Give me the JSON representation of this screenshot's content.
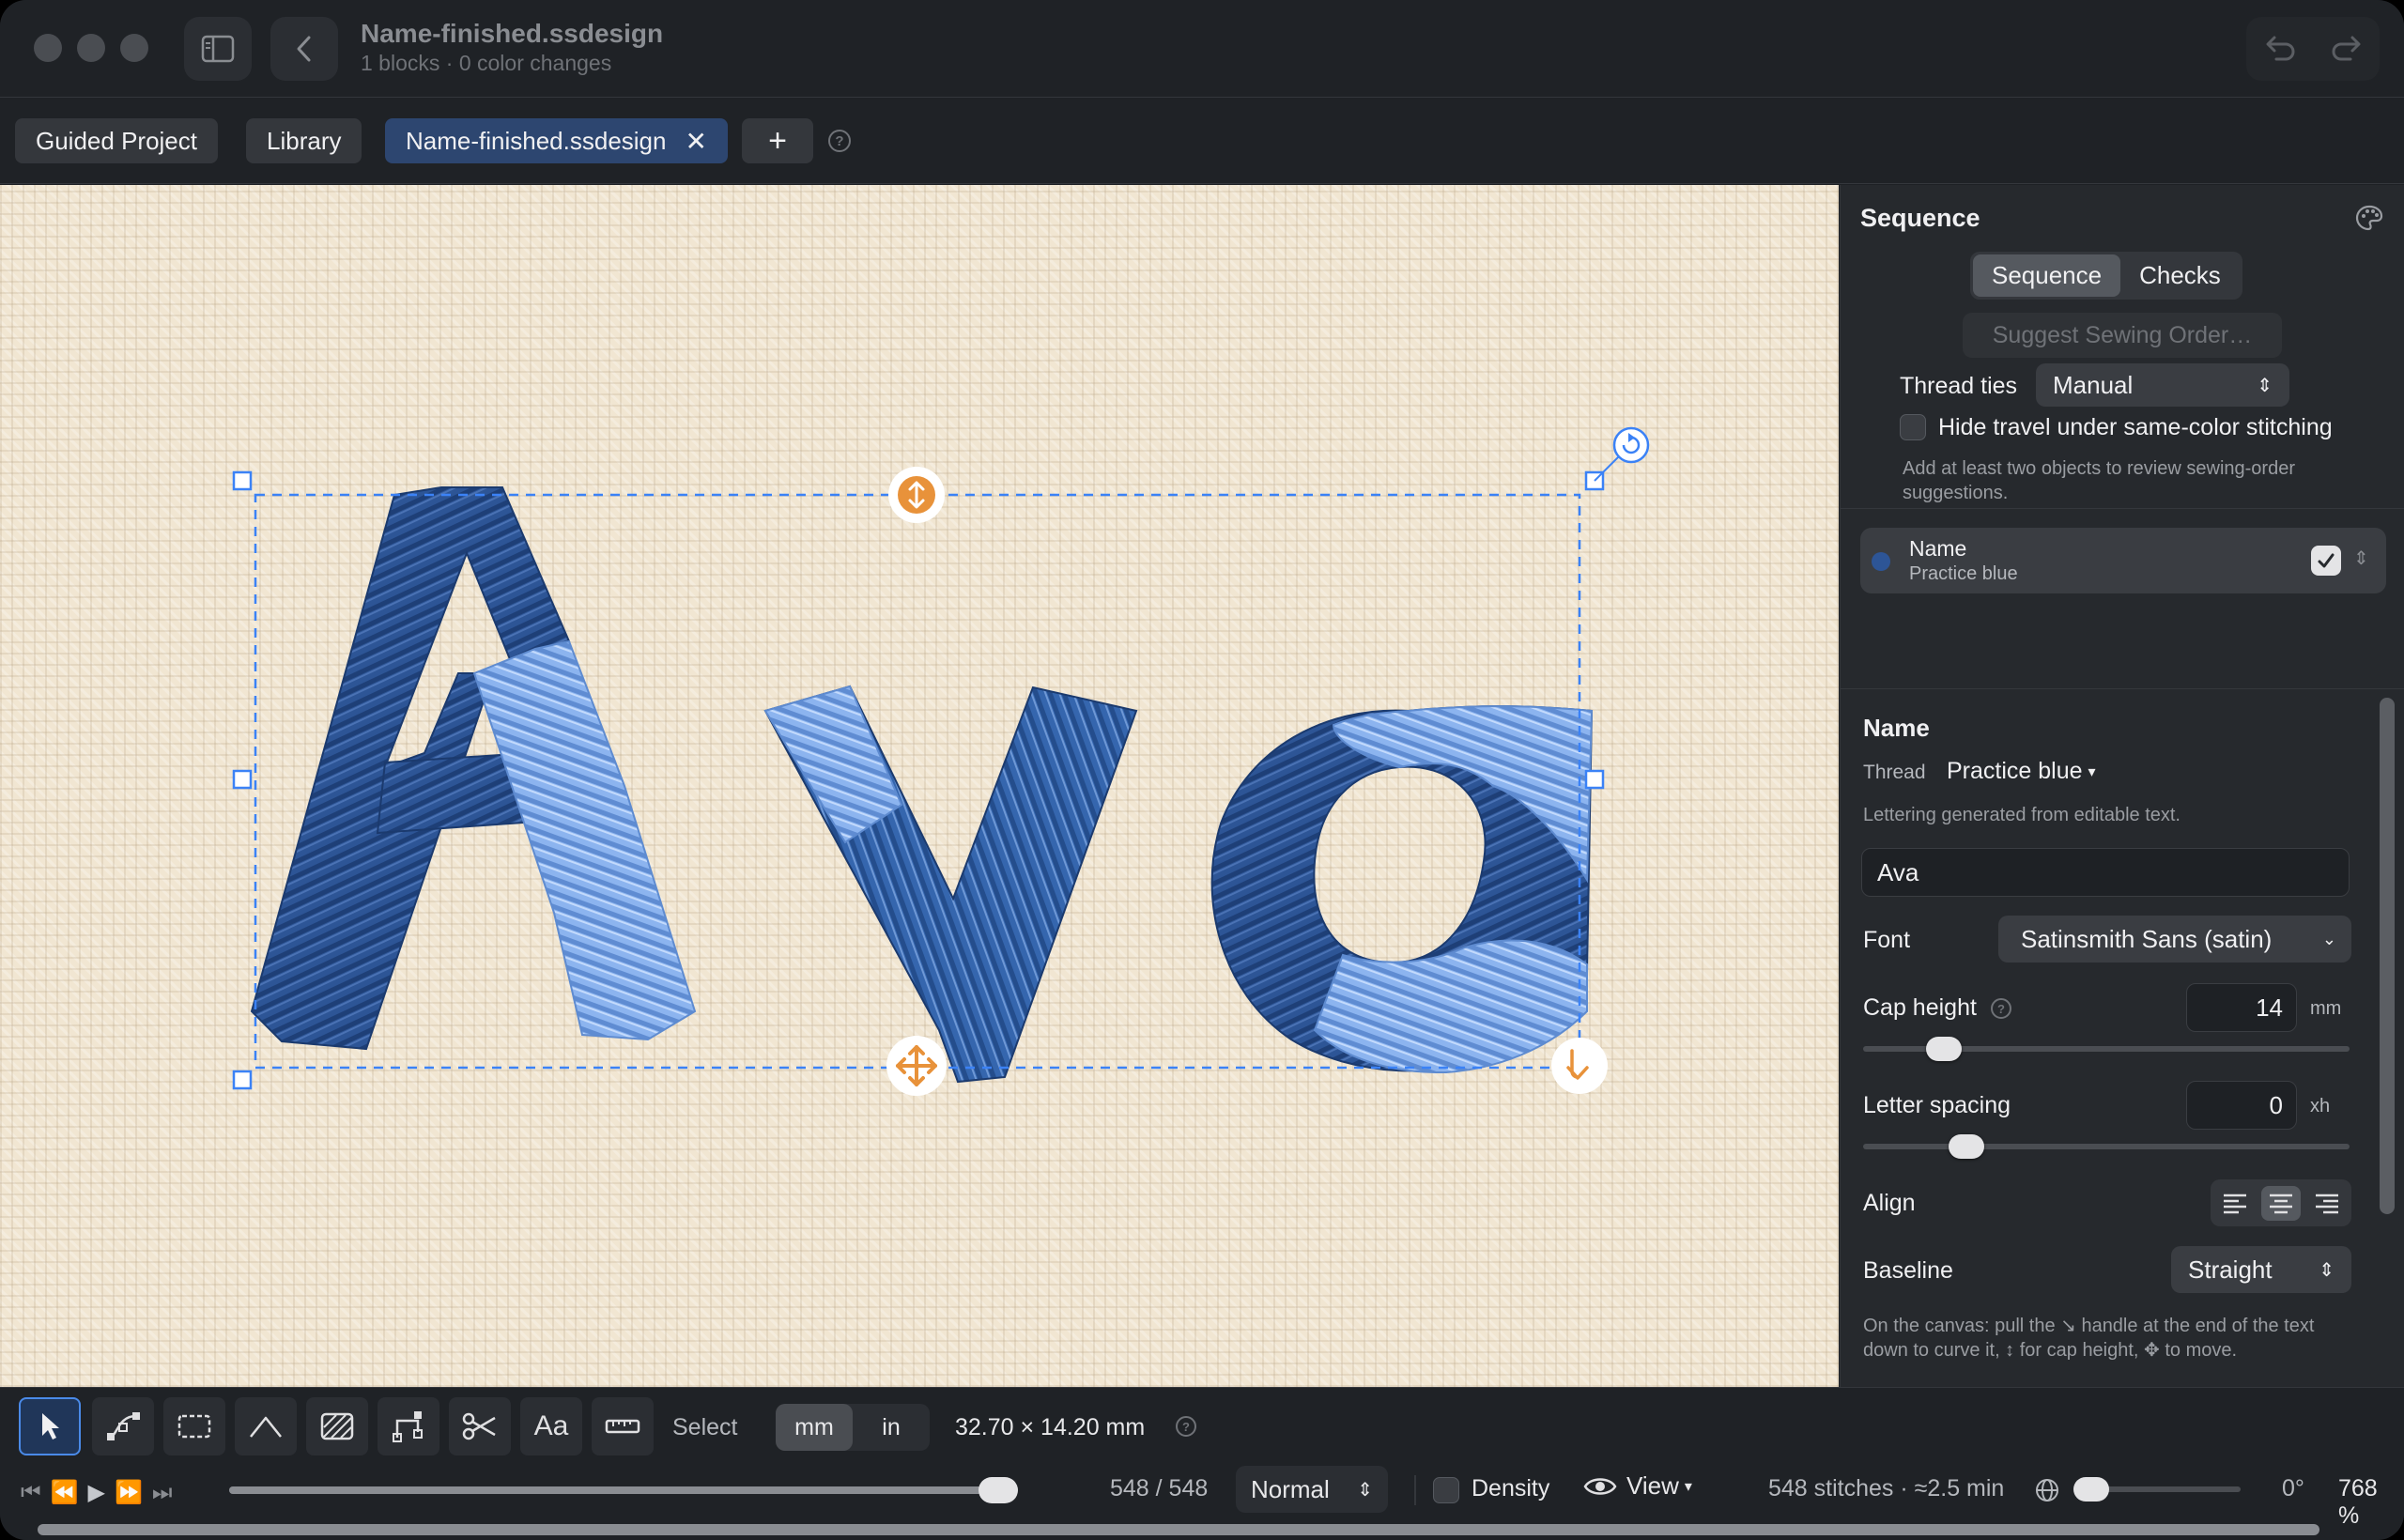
{
  "titlebar": {
    "doc_title": "Name-finished.ssdesign",
    "doc_subtitle": "1 blocks · 0 color changes"
  },
  "tabs": [
    {
      "label": "Guided Project"
    },
    {
      "label": "Library"
    },
    {
      "label": "Name-finished.ssdesign",
      "active": true
    },
    {
      "label": "+"
    }
  ],
  "canvas": {
    "lettering_text": "Ava",
    "thread_color": "#2d5596",
    "highlight_color": "#8cb4ef",
    "handle_color": "#e8923a",
    "selection_color": "#3b82f6"
  },
  "sequence_panel": {
    "title": "Sequence",
    "segments": [
      "Sequence",
      "Checks"
    ],
    "suggest_button": "Suggest Sewing Order…",
    "thread_ties_label": "Thread ties",
    "thread_ties_value": "Manual",
    "hide_travel_label": "Hide travel under same-color stitching",
    "hint": "Add at least two objects to review sewing-order suggestions.",
    "object": {
      "name": "Name",
      "thread": "Practice blue",
      "checked": true
    }
  },
  "inspector": {
    "title": "Name",
    "thread_label": "Thread",
    "thread_value": "Practice blue",
    "description": "Lettering generated from editable text.",
    "text_value": "Ava",
    "font_label": "Font",
    "font_value": "Satinsmith Sans (satin)",
    "cap_height_label": "Cap height",
    "cap_height_value": "14",
    "cap_height_unit": "mm",
    "cap_height_level": 0.14,
    "letter_spacing_label": "Letter spacing",
    "letter_spacing_value": "0",
    "letter_spacing_unit": "xh",
    "letter_spacing_level": 0.19,
    "align_label": "Align",
    "align_selected": "center",
    "baseline_label": "Baseline",
    "baseline_value": "Straight",
    "canvas_hint": "On the canvas: pull the ↘ handle at the end of the text down to curve it, ↕ for cap height, ✥ to move."
  },
  "toolbar": {
    "mode_label": "Select",
    "units": [
      "mm",
      "in"
    ],
    "selected_unit": "mm",
    "dimensions": "32.70 × 14.20 mm"
  },
  "playbar": {
    "position": "548 / 548",
    "progress_level": 1.0,
    "speed": "Normal",
    "density_label": "Density",
    "view_label": "View",
    "stats": "548 stitches · ≈2.5 min",
    "rotation": "0°",
    "zoom": "768 %"
  }
}
